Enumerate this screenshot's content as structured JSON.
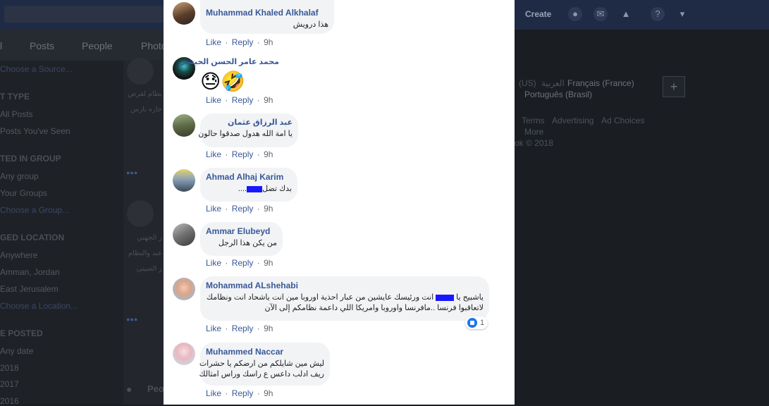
{
  "topbar": {
    "create_label": "Create"
  },
  "tabs": [
    {
      "label": "l"
    },
    {
      "label": "Posts"
    },
    {
      "label": "People"
    },
    {
      "label": "Photo"
    }
  ],
  "filters": {
    "choose_source": "Choose a Source...",
    "post_type_heading": "T TYPE",
    "all_posts": "All Posts",
    "posts_seen": "Posts You've Seen",
    "posted_in_group_heading": "TED IN GROUP",
    "any_group": "Any group",
    "your_groups": "Your Groups",
    "choose_group": "Choose a Group...",
    "tagged_location_heading": "GED LOCATION",
    "anywhere": "Anywhere",
    "amman": "Amman, Jordan",
    "east_jerusalem": "East Jerusalem",
    "choose_location": "Choose a Location...",
    "date_posted_heading": "E POSTED",
    "any_date": "Any date",
    "year_2018": "2018",
    "year_2017": "2017",
    "year_2016": "2016"
  },
  "mid_column": {
    "text_1": "بطام لفرض",
    "text_2": "حاره بارس",
    "text_3": "ر الجهني",
    "text_4": "عيد والنظام",
    "text_5": "ر الصيني",
    "people_heading": "Peo"
  },
  "right_column": {
    "lang_us": "(US)",
    "lang_ar": "العربية",
    "lang_fr": "Français (France)",
    "lang_pt": "Português (Brasil)",
    "plus": "+",
    "terms": "Terms",
    "advertising": "Advertising",
    "ad_choices": "Ad Choices",
    "more": "More",
    "copyright": "ok © 2018"
  },
  "comment_actions": {
    "like": "Like",
    "reply": "Reply",
    "separator": "·"
  },
  "comments": [
    {
      "name": "Muhammad Khaled Alkhalaf",
      "text": "هذا درويش",
      "time": "9h"
    },
    {
      "name": "محمد عامر الحسن الحيشي",
      "emoji": "😓🤣",
      "time": "9h"
    },
    {
      "name": "عبد الرزاق عثمان",
      "text": "يا امة الله هدول صدقوا حالون",
      "time": "9h"
    },
    {
      "name": "Ahmad Alhaj Karim",
      "text": "بدك تضل",
      "text_suffix": "....",
      "time": "9h"
    },
    {
      "name": "Ammar Elubeyd",
      "text": "من يكن هذا الرجل",
      "time": "9h"
    },
    {
      "name": "Mohammad ALshehabi",
      "text_line1_a": "ياشبيح يا",
      "text_line1_b": "انت ورئيسك عايشين من عبار احذية اوروبا مين انت ياشحاد انت ونظامك",
      "text_line2": "لاتعاقبوا فرنسا ..مافرنسا واوروبا وامريكا اللي داعمة نظامكم إلى الآن",
      "reaction_count": "1",
      "time": "9h"
    },
    {
      "name": "Muhammed Naccar",
      "text_line1": "ليش مين شايلكم من ارضكم يا حشرات",
      "text_line2": "ريف ادلب داعس ع راسك وراس امثالك",
      "time": "9h"
    }
  ],
  "colors": {
    "name_blue": "#385898",
    "bubble_bg": "#f2f3f5",
    "like_blue": "#1877f2",
    "topbar_dim": "#1f2b45"
  },
  "icons": {
    "friends": "friends-icon",
    "messenger": "messenger-icon",
    "notifications": "bell-icon",
    "help": "help-icon",
    "dropdown": "caret-down-icon"
  }
}
